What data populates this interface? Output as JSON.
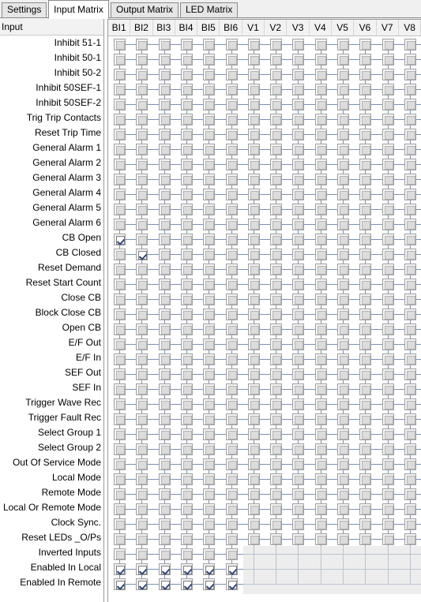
{
  "window": {
    "title": "Input Matrix"
  },
  "tabs": [
    {
      "label": "Settings",
      "active": false
    },
    {
      "label": "Input Matrix",
      "active": true
    },
    {
      "label": "Output Matrix",
      "active": false
    },
    {
      "label": "LED Matrix",
      "active": false
    }
  ],
  "matrix": {
    "row_header_label": "Input",
    "columns": [
      "BI1",
      "BI2",
      "BI3",
      "BI4",
      "BI5",
      "BI6",
      "V1",
      "V2",
      "V3",
      "V4",
      "V5",
      "V6",
      "V7",
      "V8"
    ],
    "rows": [
      {
        "label": "Inhibit 51-1",
        "checked": [],
        "disabled_from": null
      },
      {
        "label": "Inhibit 50-1",
        "checked": [],
        "disabled_from": null
      },
      {
        "label": "Inhibit 50-2",
        "checked": [],
        "disabled_from": null
      },
      {
        "label": "Inhibit 50SEF-1",
        "checked": [],
        "disabled_from": null
      },
      {
        "label": "Inhibit 50SEF-2",
        "checked": [],
        "disabled_from": null
      },
      {
        "label": "Trig Trip Contacts",
        "checked": [],
        "disabled_from": null
      },
      {
        "label": "Reset Trip Time",
        "checked": [],
        "disabled_from": null
      },
      {
        "label": "General Alarm 1",
        "checked": [],
        "disabled_from": null
      },
      {
        "label": "General Alarm 2",
        "checked": [],
        "disabled_from": null
      },
      {
        "label": "General Alarm 3",
        "checked": [],
        "disabled_from": null
      },
      {
        "label": "General Alarm 4",
        "checked": [],
        "disabled_from": null
      },
      {
        "label": "General Alarm 5",
        "checked": [],
        "disabled_from": null
      },
      {
        "label": "General Alarm 6",
        "checked": [],
        "disabled_from": null
      },
      {
        "label": "CB Open",
        "checked": [
          0
        ],
        "disabled_from": null
      },
      {
        "label": "CB Closed",
        "checked": [
          1
        ],
        "disabled_from": null
      },
      {
        "label": "Reset Demand",
        "checked": [],
        "disabled_from": null
      },
      {
        "label": "Reset Start Count",
        "checked": [],
        "disabled_from": null
      },
      {
        "label": "Close CB",
        "checked": [],
        "disabled_from": null
      },
      {
        "label": "Block Close CB",
        "checked": [],
        "disabled_from": null
      },
      {
        "label": "Open CB",
        "checked": [],
        "disabled_from": null
      },
      {
        "label": "E/F Out",
        "checked": [],
        "disabled_from": null
      },
      {
        "label": "E/F In",
        "checked": [],
        "disabled_from": null
      },
      {
        "label": "SEF Out",
        "checked": [],
        "disabled_from": null
      },
      {
        "label": "SEF In",
        "checked": [],
        "disabled_from": null
      },
      {
        "label": "Trigger Wave Rec",
        "checked": [],
        "disabled_from": null
      },
      {
        "label": "Trigger Fault Rec",
        "checked": [],
        "disabled_from": null
      },
      {
        "label": "Select Group 1",
        "checked": [],
        "disabled_from": null
      },
      {
        "label": "Select Group 2",
        "checked": [],
        "disabled_from": null
      },
      {
        "label": "Out Of Service Mode",
        "checked": [],
        "disabled_from": null
      },
      {
        "label": "Local Mode",
        "checked": [],
        "disabled_from": null
      },
      {
        "label": "Remote Mode",
        "checked": [],
        "disabled_from": null
      },
      {
        "label": "Local Or Remote Mode",
        "checked": [],
        "disabled_from": null
      },
      {
        "label": "Clock Sync.",
        "checked": [],
        "disabled_from": null
      },
      {
        "label": "Reset LEDs _O/Ps",
        "checked": [],
        "disabled_from": null
      },
      {
        "label": "Inverted Inputs",
        "checked": [],
        "disabled_from": 6
      },
      {
        "label": "Enabled In Local",
        "checked": [
          0,
          1,
          2,
          3,
          4,
          5
        ],
        "disabled_from": 6
      },
      {
        "label": "Enabled In Remote",
        "checked": [
          0,
          1,
          2,
          3,
          4,
          5
        ],
        "disabled_from": 6
      }
    ]
  },
  "colors": {
    "connector_line": "#7b92b4",
    "checkmark": "#33497a",
    "header_bg": "#f2f2f2",
    "panel_border": "#9a9a9a",
    "tab_inactive_bg": "#e6e6e6"
  }
}
